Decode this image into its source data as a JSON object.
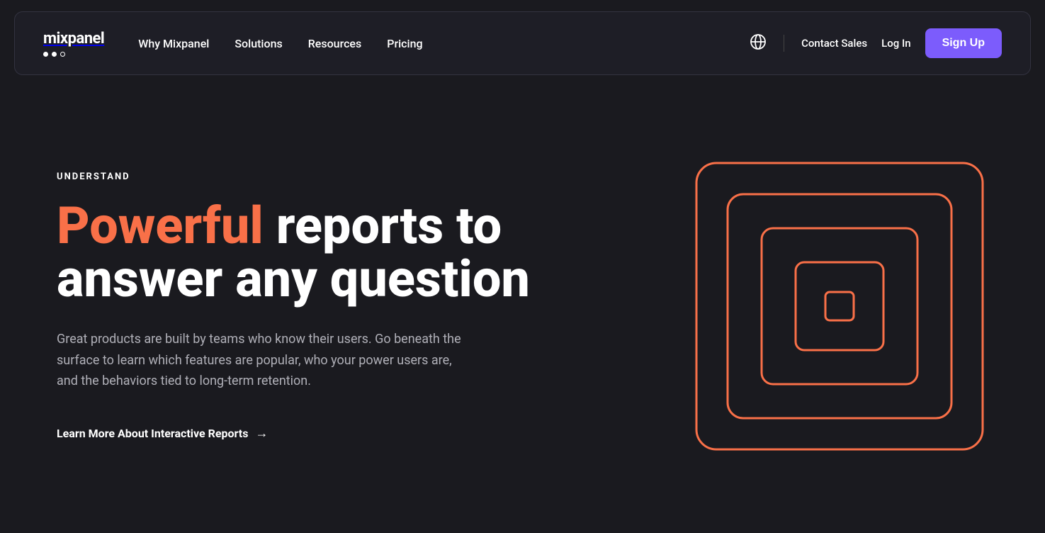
{
  "nav": {
    "logo": {
      "text": "mixpanel"
    },
    "links": [
      {
        "label": "Why Mixpanel",
        "href": "#"
      },
      {
        "label": "Solutions",
        "href": "#"
      },
      {
        "label": "Resources",
        "href": "#"
      },
      {
        "label": "Pricing",
        "href": "#"
      }
    ],
    "contact_sales": "Contact Sales",
    "log_in": "Log In",
    "sign_up": "Sign Up"
  },
  "hero": {
    "label": "UNDERSTAND",
    "heading_highlight": "Powerful",
    "heading_rest": " reports to answer any question",
    "description": "Great products are built by teams who know their users. Go beneath the surface to learn which features are popular, who your power users are, and the behaviors tied to long-term retention.",
    "cta_label": "Learn More About Interactive Reports",
    "cta_arrow": "→"
  },
  "colors": {
    "accent": "#f97048",
    "purple": "#7c5cfc",
    "bg": "#1a1a1f",
    "nav_bg": "#1e1e26"
  }
}
